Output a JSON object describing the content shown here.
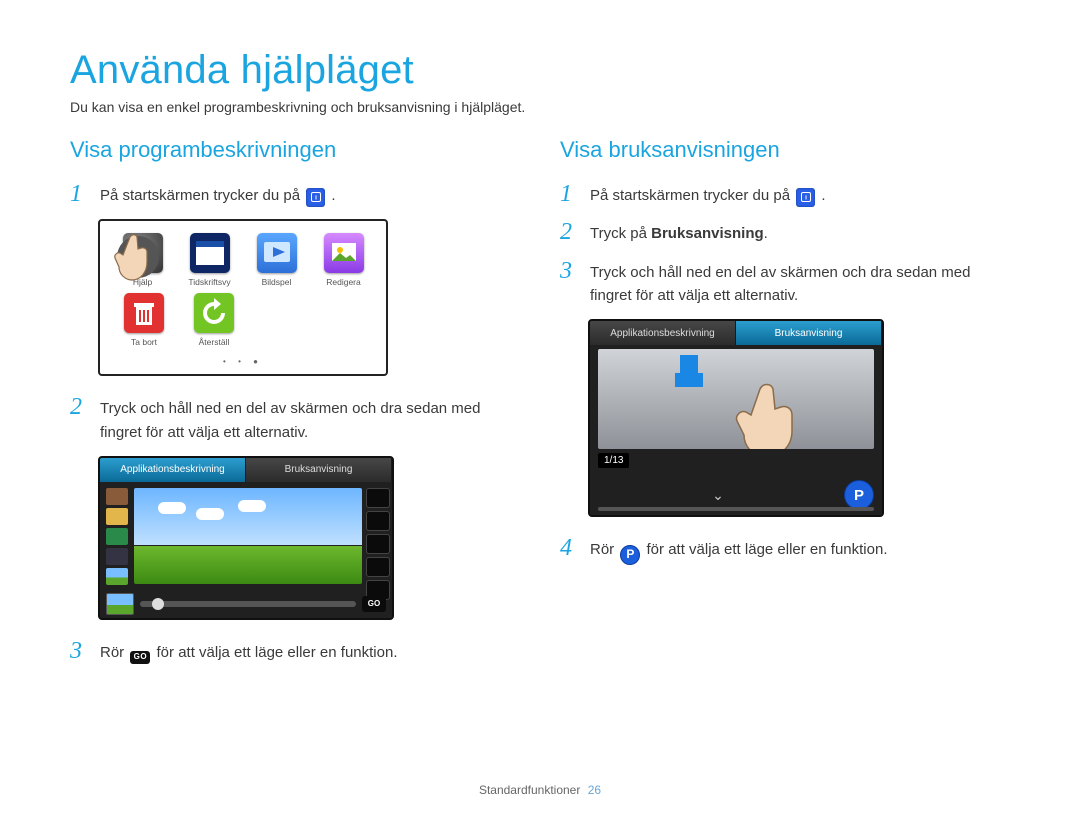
{
  "page_title": "Använda hjälpläget",
  "intro": "Du kan visa en enkel programbeskrivning och bruksanvisning i hjälpläget.",
  "footer": {
    "section": "Standardfunktioner",
    "page": "26"
  },
  "left": {
    "title": "Visa programbeskrivningen",
    "step1_prefix": "På startskärmen trycker du på ",
    "step1_suffix": ".",
    "step2": "Tryck och håll ned en del av skärmen och dra sedan med fingret för att välja ett alternativ.",
    "step3_prefix": "Rör ",
    "step3_suffix": " för att välja ett läge eller en funktion."
  },
  "right": {
    "title": "Visa bruksanvisningen",
    "step1_prefix": "På startskärmen trycker du på ",
    "step1_suffix": ".",
    "step2": "Tryck på ",
    "step2_bold": "Bruksanvisning",
    "step2_suffix": ".",
    "step3": "Tryck och håll ned en del av skärmen och dra sedan med fingret för att välja ett alternativ.",
    "step4_prefix": "Rör ",
    "step4_suffix": " för att välja ett läge eller en funktion."
  },
  "apps": {
    "help": "Hjälp",
    "mag": "Tidskriftsvy",
    "slide": "Bildspel",
    "edit": "Redigera",
    "del": "Ta bort",
    "reset": "Återställ"
  },
  "tabs": {
    "app": "Applikationsbeskrivning",
    "man": "Bruksanvisning"
  },
  "go": "GO",
  "counter": "1/13",
  "p": "P"
}
